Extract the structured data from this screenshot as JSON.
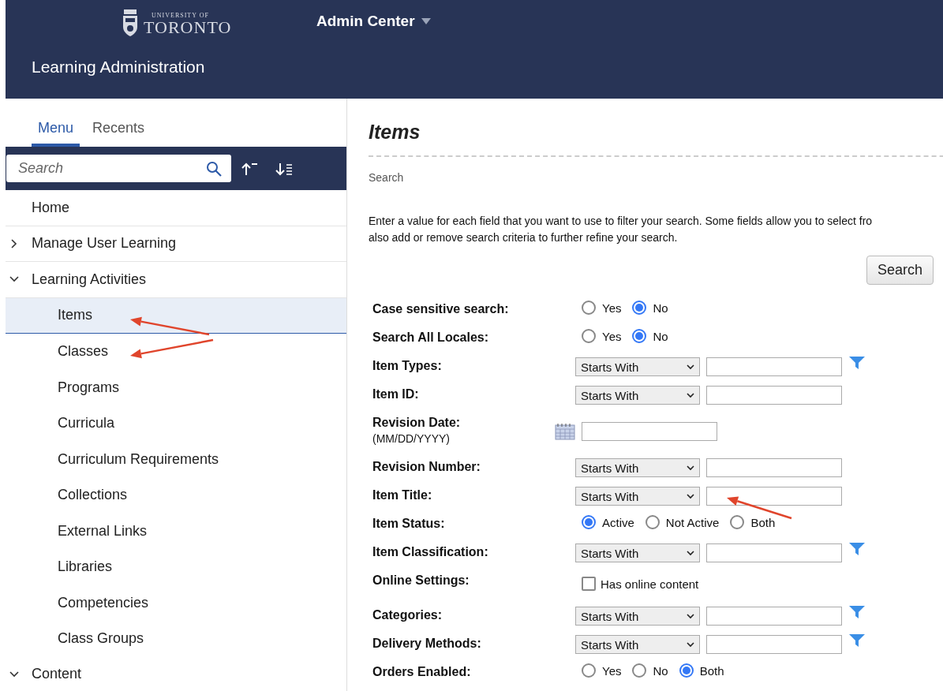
{
  "header": {
    "logo": {
      "line1": "UNIVERSITY OF",
      "line2": "TORONTO"
    },
    "app_menu": "Admin Center",
    "title": "Learning Administration"
  },
  "sidebar": {
    "tabs": [
      {
        "label": "Menu",
        "selected": true
      },
      {
        "label": "Recents",
        "selected": false
      }
    ],
    "search": {
      "placeholder": "Search"
    },
    "items": [
      {
        "label": "Home"
      },
      {
        "label": "Manage User Learning",
        "expanded": false
      },
      {
        "label": "Learning Activities",
        "expanded": true,
        "children": [
          {
            "label": "Items",
            "selected": true
          },
          {
            "label": "Classes",
            "selected": false
          },
          {
            "label": "Programs",
            "selected": false
          },
          {
            "label": "Curricula",
            "selected": false
          },
          {
            "label": "Curriculum Requirements",
            "selected": false
          },
          {
            "label": "Collections",
            "selected": false
          },
          {
            "label": "External Links",
            "selected": false
          },
          {
            "label": "Libraries",
            "selected": false
          },
          {
            "label": "Competencies",
            "selected": false
          },
          {
            "label": "Class Groups",
            "selected": false
          }
        ]
      },
      {
        "label": "Content",
        "expanded": true
      }
    ]
  },
  "main": {
    "title": "Items",
    "section": "Search",
    "intro": [
      "Enter a value for each field that you want to use to filter your search. Some fields allow you to select fro",
      "also add or remove search criteria to further refine your search."
    ],
    "search_button": "Search",
    "fields": [
      {
        "kind": "radio",
        "label": "Case sensitive search:",
        "options": [
          {
            "label": "Yes",
            "selected": false
          },
          {
            "label": "No",
            "selected": true
          }
        ]
      },
      {
        "kind": "radio",
        "label": "Search All Locales:",
        "options": [
          {
            "label": "Yes",
            "selected": false
          },
          {
            "label": "No",
            "selected": true
          }
        ]
      },
      {
        "kind": "select",
        "label": "Item Types:",
        "operator": "Starts With",
        "filter": true
      },
      {
        "kind": "select",
        "label": "Item ID:",
        "operator": "Starts With",
        "filter": false
      },
      {
        "kind": "date",
        "label": "Revision Date:",
        "hint": "(MM/DD/YYYY)"
      },
      {
        "kind": "select",
        "label": "Revision Number:",
        "operator": "Starts With",
        "filter": false
      },
      {
        "kind": "select",
        "label": "Item Title:",
        "operator": "Starts With",
        "filter": false
      },
      {
        "kind": "radio",
        "label": "Item Status:",
        "options": [
          {
            "label": "Active",
            "selected": true
          },
          {
            "label": "Not Active",
            "selected": false
          },
          {
            "label": "Both",
            "selected": false
          }
        ]
      },
      {
        "kind": "select",
        "label": "Item Classification:",
        "operator": "Starts With",
        "filter": true
      },
      {
        "kind": "checkbox",
        "label": "Online Settings:",
        "text": "Has online content",
        "checked": false
      },
      {
        "kind": "select",
        "label": "Categories:",
        "operator": "Starts With",
        "filter": true
      },
      {
        "kind": "select",
        "label": "Delivery Methods:",
        "operator": "Starts With",
        "filter": true
      },
      {
        "kind": "radio",
        "label": "Orders Enabled:",
        "options": [
          {
            "label": "Yes",
            "selected": false
          },
          {
            "label": "No",
            "selected": false
          },
          {
            "label": "Both",
            "selected": true
          }
        ]
      }
    ]
  }
}
